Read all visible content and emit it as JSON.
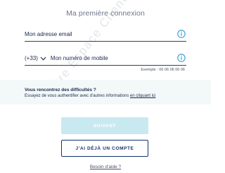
{
  "page": {
    "title": "Ma première connexion",
    "watermark": "Votre Espace Client"
  },
  "email": {
    "placeholder": "Mon adresse email",
    "value": "",
    "icon": "info-icon"
  },
  "phone": {
    "prefix": "(+33)",
    "placeholder": "Mon numéro de mobile",
    "value": "",
    "icon": "info-icon",
    "example": "Exemple : 06 06 06 06 06"
  },
  "help": {
    "title": "Vous rencontrez des difficultés ?",
    "text": "Essayez de vous authentifier avec d'autres informations ",
    "link": "en cliquant ici"
  },
  "buttons": {
    "submit": "SUIVANT",
    "account": "J'AI DÉJÀ UN COMPTE"
  },
  "footer": {
    "need_help": "Besoin d'aide ?"
  },
  "colors": {
    "primary": "#12336b",
    "accent": "#1d8fc7",
    "disabled_button": "#c9e9f1",
    "help_band": "#f3f8f9"
  }
}
